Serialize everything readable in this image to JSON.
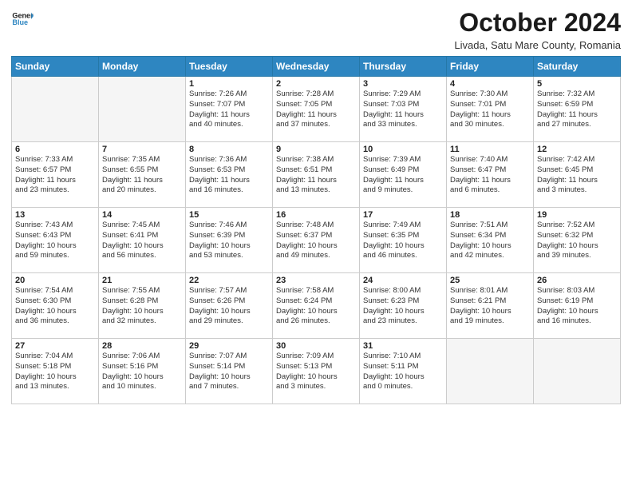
{
  "header": {
    "logo_line1": "General",
    "logo_line2": "Blue",
    "month_title": "October 2024",
    "location": "Livada, Satu Mare County, Romania"
  },
  "weekdays": [
    "Sunday",
    "Monday",
    "Tuesday",
    "Wednesday",
    "Thursday",
    "Friday",
    "Saturday"
  ],
  "weeks": [
    [
      {
        "num": "",
        "detail": ""
      },
      {
        "num": "",
        "detail": ""
      },
      {
        "num": "1",
        "detail": "Sunrise: 7:26 AM\nSunset: 7:07 PM\nDaylight: 11 hours\nand 40 minutes."
      },
      {
        "num": "2",
        "detail": "Sunrise: 7:28 AM\nSunset: 7:05 PM\nDaylight: 11 hours\nand 37 minutes."
      },
      {
        "num": "3",
        "detail": "Sunrise: 7:29 AM\nSunset: 7:03 PM\nDaylight: 11 hours\nand 33 minutes."
      },
      {
        "num": "4",
        "detail": "Sunrise: 7:30 AM\nSunset: 7:01 PM\nDaylight: 11 hours\nand 30 minutes."
      },
      {
        "num": "5",
        "detail": "Sunrise: 7:32 AM\nSunset: 6:59 PM\nDaylight: 11 hours\nand 27 minutes."
      }
    ],
    [
      {
        "num": "6",
        "detail": "Sunrise: 7:33 AM\nSunset: 6:57 PM\nDaylight: 11 hours\nand 23 minutes."
      },
      {
        "num": "7",
        "detail": "Sunrise: 7:35 AM\nSunset: 6:55 PM\nDaylight: 11 hours\nand 20 minutes."
      },
      {
        "num": "8",
        "detail": "Sunrise: 7:36 AM\nSunset: 6:53 PM\nDaylight: 11 hours\nand 16 minutes."
      },
      {
        "num": "9",
        "detail": "Sunrise: 7:38 AM\nSunset: 6:51 PM\nDaylight: 11 hours\nand 13 minutes."
      },
      {
        "num": "10",
        "detail": "Sunrise: 7:39 AM\nSunset: 6:49 PM\nDaylight: 11 hours\nand 9 minutes."
      },
      {
        "num": "11",
        "detail": "Sunrise: 7:40 AM\nSunset: 6:47 PM\nDaylight: 11 hours\nand 6 minutes."
      },
      {
        "num": "12",
        "detail": "Sunrise: 7:42 AM\nSunset: 6:45 PM\nDaylight: 11 hours\nand 3 minutes."
      }
    ],
    [
      {
        "num": "13",
        "detail": "Sunrise: 7:43 AM\nSunset: 6:43 PM\nDaylight: 10 hours\nand 59 minutes."
      },
      {
        "num": "14",
        "detail": "Sunrise: 7:45 AM\nSunset: 6:41 PM\nDaylight: 10 hours\nand 56 minutes."
      },
      {
        "num": "15",
        "detail": "Sunrise: 7:46 AM\nSunset: 6:39 PM\nDaylight: 10 hours\nand 53 minutes."
      },
      {
        "num": "16",
        "detail": "Sunrise: 7:48 AM\nSunset: 6:37 PM\nDaylight: 10 hours\nand 49 minutes."
      },
      {
        "num": "17",
        "detail": "Sunrise: 7:49 AM\nSunset: 6:35 PM\nDaylight: 10 hours\nand 46 minutes."
      },
      {
        "num": "18",
        "detail": "Sunrise: 7:51 AM\nSunset: 6:34 PM\nDaylight: 10 hours\nand 42 minutes."
      },
      {
        "num": "19",
        "detail": "Sunrise: 7:52 AM\nSunset: 6:32 PM\nDaylight: 10 hours\nand 39 minutes."
      }
    ],
    [
      {
        "num": "20",
        "detail": "Sunrise: 7:54 AM\nSunset: 6:30 PM\nDaylight: 10 hours\nand 36 minutes."
      },
      {
        "num": "21",
        "detail": "Sunrise: 7:55 AM\nSunset: 6:28 PM\nDaylight: 10 hours\nand 32 minutes."
      },
      {
        "num": "22",
        "detail": "Sunrise: 7:57 AM\nSunset: 6:26 PM\nDaylight: 10 hours\nand 29 minutes."
      },
      {
        "num": "23",
        "detail": "Sunrise: 7:58 AM\nSunset: 6:24 PM\nDaylight: 10 hours\nand 26 minutes."
      },
      {
        "num": "24",
        "detail": "Sunrise: 8:00 AM\nSunset: 6:23 PM\nDaylight: 10 hours\nand 23 minutes."
      },
      {
        "num": "25",
        "detail": "Sunrise: 8:01 AM\nSunset: 6:21 PM\nDaylight: 10 hours\nand 19 minutes."
      },
      {
        "num": "26",
        "detail": "Sunrise: 8:03 AM\nSunset: 6:19 PM\nDaylight: 10 hours\nand 16 minutes."
      }
    ],
    [
      {
        "num": "27",
        "detail": "Sunrise: 7:04 AM\nSunset: 5:18 PM\nDaylight: 10 hours\nand 13 minutes."
      },
      {
        "num": "28",
        "detail": "Sunrise: 7:06 AM\nSunset: 5:16 PM\nDaylight: 10 hours\nand 10 minutes."
      },
      {
        "num": "29",
        "detail": "Sunrise: 7:07 AM\nSunset: 5:14 PM\nDaylight: 10 hours\nand 7 minutes."
      },
      {
        "num": "30",
        "detail": "Sunrise: 7:09 AM\nSunset: 5:13 PM\nDaylight: 10 hours\nand 3 minutes."
      },
      {
        "num": "31",
        "detail": "Sunrise: 7:10 AM\nSunset: 5:11 PM\nDaylight: 10 hours\nand 0 minutes."
      },
      {
        "num": "",
        "detail": ""
      },
      {
        "num": "",
        "detail": ""
      }
    ]
  ]
}
